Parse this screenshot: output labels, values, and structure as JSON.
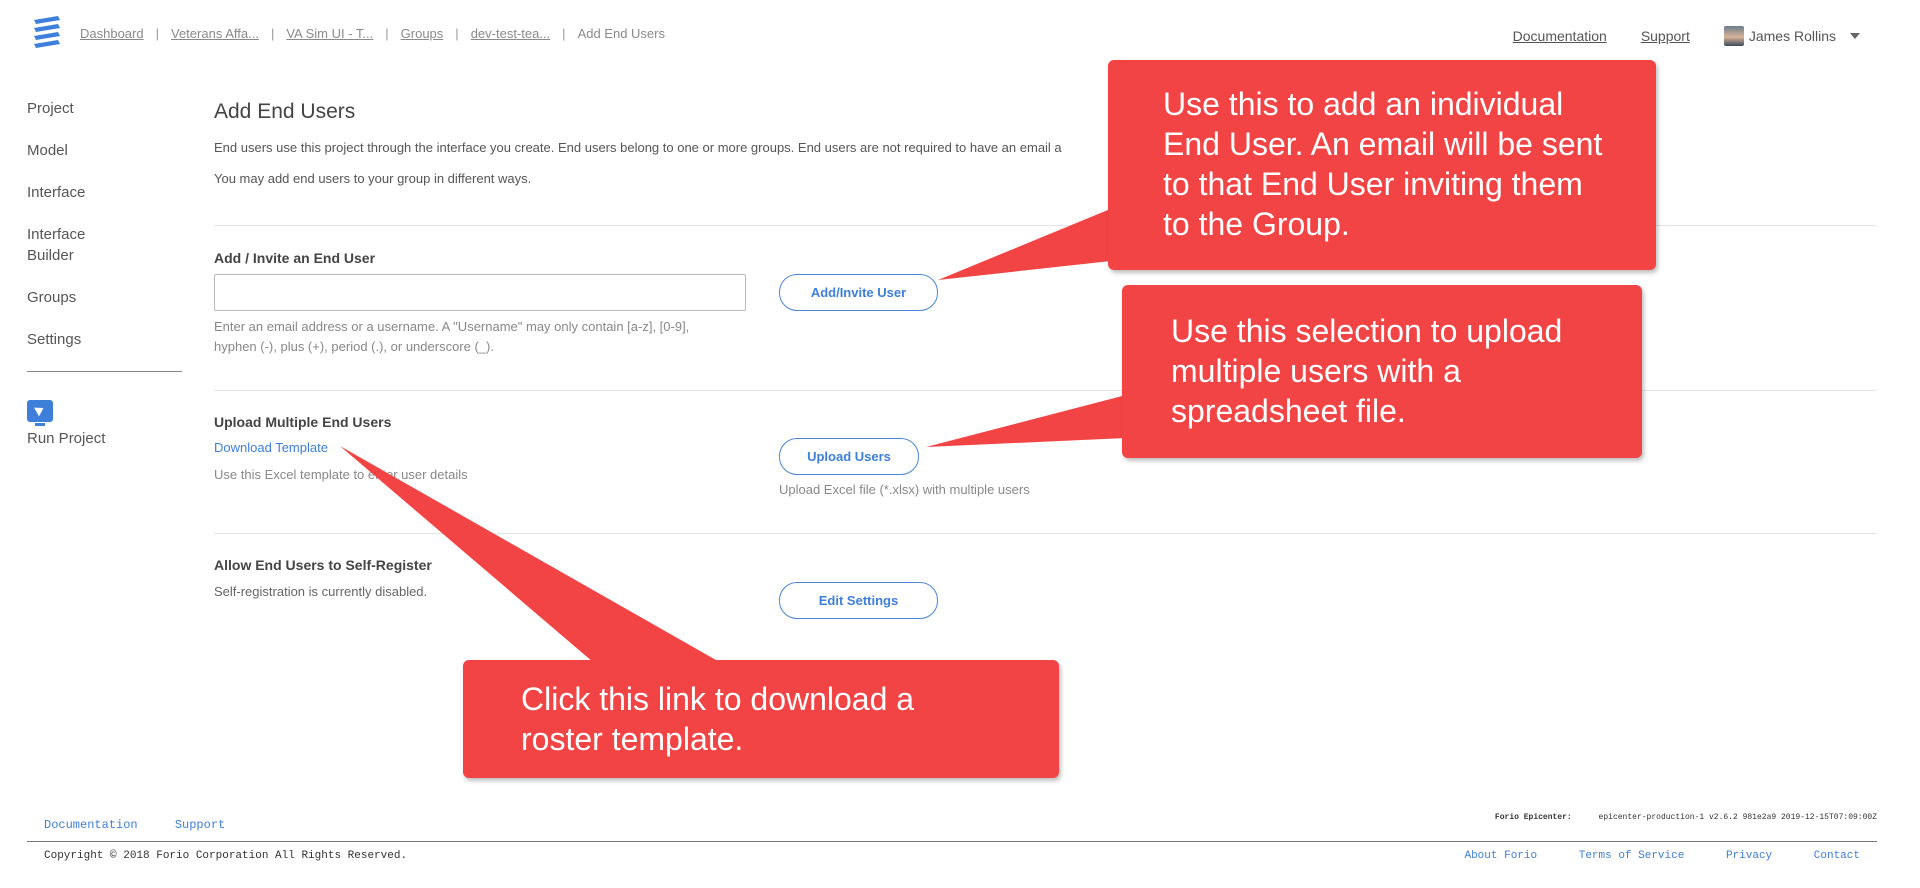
{
  "header": {
    "breadcrumb": [
      {
        "label": "Dashboard"
      },
      {
        "label": "Veterans Affa..."
      },
      {
        "label": "VA Sim UI - T..."
      },
      {
        "label": "Groups"
      },
      {
        "label": "dev-test-tea..."
      }
    ],
    "breadcrumb_current": "Add End Users",
    "documentation_link": "Documentation",
    "support_link": "Support",
    "user_name": "James Rollins"
  },
  "sidebar": {
    "items": [
      {
        "label": "Project"
      },
      {
        "label": "Model"
      },
      {
        "label": "Interface"
      },
      {
        "label": "Interface Builder"
      },
      {
        "label": "Groups"
      },
      {
        "label": "Settings"
      }
    ],
    "run_project_label": "Run Project"
  },
  "main": {
    "title": "Add End Users",
    "intro_line1": "End users use this project through the interface you create. End users belong to one or more groups. End users are not required to have an email a",
    "intro_line2": "You may add end users to your group in different ways.",
    "add_section": {
      "title": "Add / Invite an End User",
      "input_value": "",
      "help_line1": "Enter an email address or a username. A \"Username\" may only contain [a-z], [0-9],",
      "help_line2": "hyphen (-), plus (+), period (.), or underscore (_).",
      "button_label": "Add/Invite User"
    },
    "upload_section": {
      "title": "Upload Multiple End Users",
      "download_link": "Download Template",
      "template_help": "Use this Excel template to enter user details",
      "button_label": "Upload Users",
      "upload_help": "Upload Excel file (*.xlsx) with multiple users"
    },
    "self_register_section": {
      "title": "Allow End Users to Self-Register",
      "status": "Self-registration is currently disabled.",
      "button_label": "Edit Settings"
    }
  },
  "callouts": {
    "add_user": "Use this to add an individual End User.  An email will be sent to that End User inviting them to the Group.",
    "upload": "Use this selection to upload multiple users with a spreadsheet file.",
    "download": "Click this link to download a roster template."
  },
  "footer": {
    "documentation_link": "Documentation",
    "support_link": "Support",
    "copyright": "Copyright © 2018 Forio Corporation All Rights Reserved.",
    "version_label": "Forio Epicenter:",
    "version_value": "epicenter-production-1 v2.6.2 981e2a9 2019-12-15T07:09:00Z",
    "about_link": "About Forio",
    "terms_link": "Terms of Service",
    "privacy_link": "Privacy",
    "contact_link": "Contact"
  },
  "colors": {
    "accent": "#3e7fd9",
    "callout": "#f24444"
  }
}
